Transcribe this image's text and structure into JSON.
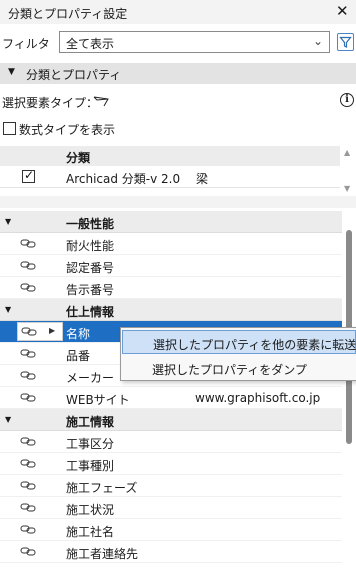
{
  "window": {
    "title": "分類とプロパティ設定",
    "close_glyph": "✕"
  },
  "filter": {
    "label": "フィルタ",
    "selected": "全て表示"
  },
  "section": {
    "label": "分類とプロパティ"
  },
  "element_type": {
    "label": "選択要素タイプ："
  },
  "formula_toggle": {
    "label": "数式タイプを表示"
  },
  "classification": {
    "header": "分類",
    "rows": [
      {
        "checked": true,
        "system": "Archicad 分類-v 2.0",
        "class": "梁"
      }
    ]
  },
  "properties": {
    "groups": [
      {
        "label": "一般性能",
        "items": [
          {
            "name": "耐火性能"
          },
          {
            "name": "認定番号"
          },
          {
            "name": "告示番号"
          }
        ]
      },
      {
        "label": "仕上情報",
        "items": [
          {
            "name": "名称",
            "selected": true
          },
          {
            "name": "品番"
          },
          {
            "name": "メーカー"
          },
          {
            "name": "WEBサイト",
            "value": "www.graphisoft.co.jp"
          }
        ]
      },
      {
        "label": "施工情報",
        "items": [
          {
            "name": "工事区分"
          },
          {
            "name": "工事種別"
          },
          {
            "name": "施工フェーズ"
          },
          {
            "name": "施工状況"
          },
          {
            "name": "施工社名"
          },
          {
            "name": "施工者連絡先"
          }
        ]
      }
    ]
  },
  "context_menu": {
    "items": [
      {
        "label": "選択したプロパティを他の要素に転送",
        "highlighted": true
      },
      {
        "label": "選択したプロパティをダンプ"
      }
    ]
  },
  "colors": {
    "selection": "#1e6fc4",
    "menu_hover": "#cfe1f7",
    "accent_blue": "#4a86c8"
  }
}
